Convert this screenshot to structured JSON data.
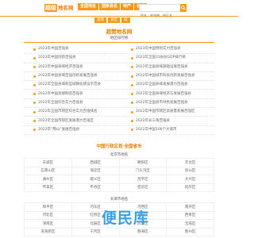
{
  "header": {
    "logo_mark": "超级",
    "logo_text": "地名网",
    "nav": [
      "全国地名",
      "国家县名",
      "特产",
      "名人"
    ],
    "search_placeholder": "地名、邮政编、城区名"
  },
  "subnav": [
    "查地",
    "县区",
    "城"
  ],
  "main": {
    "title": "超赞地名网",
    "rank_heading": "地区排行榜",
    "rankings": [
      [
        "2023年中国百强县",
        "2023年中国特别实力百强县"
      ],
      [
        "2023年中国创新百强县",
        "2023年全国31省份GDP排行榜"
      ],
      [
        "2022年中国县域经济百强县",
        "2022年全国县域基础设施百强县"
      ],
      [
        "2022年中国县域百强创新发展百强县",
        "2022年中国城市科技创新发展百强县"
      ],
      [
        "2022年全国县城新型城镇化建设示范县",
        "2022年全国县域发展潜力百强县"
      ],
      [
        "2022年中国高端制造百强县",
        "2022年全国县域经济与发展百强县"
      ],
      [
        "2022年全国综合实力百强县",
        "2022年全国县市绿色发展百强县"
      ],
      [
        "2022年全国市辖区综合实力百强排名",
        "2022年中国市辖区高质量发展百强区"
      ],
      [
        "2022年全国市辖区发展潜力百强区",
        "2022年长三角百强县"
      ],
      [
        "2022年“两山”发展百强县",
        "2022年中国106个大城市"
      ]
    ],
    "city_title": "中国行政区划·全国省市",
    "beijing_heading": "北京市地名",
    "beijing": [
      [
        "东城区",
        "西城区",
        "朝阳区",
        "丰台区"
      ],
      [
        "石景山区",
        "海淀区",
        "门头沟区",
        "房山区"
      ],
      [
        "通州区",
        "顺义区",
        "昌平区",
        "大兴区"
      ],
      [
        "怀柔区",
        "平谷区",
        "密云区",
        "延庆区"
      ]
    ],
    "tianjin_heading": "天津市地名",
    "tianjin": [
      [
        "和平区",
        "河东区",
        "河西区",
        "南开区"
      ],
      [
        "河北区",
        "红桥区",
        "东丽区",
        "西青区"
      ],
      [
        "津南区",
        "北辰区",
        "武清区",
        "宝坻区"
      ],
      [
        "滨海新区",
        "宁河区",
        "静海区",
        "蓟州区"
      ]
    ]
  },
  "watermark": "便民库",
  "colors": {
    "accent": "#f39b19",
    "watermark": "#3aa0ea"
  }
}
